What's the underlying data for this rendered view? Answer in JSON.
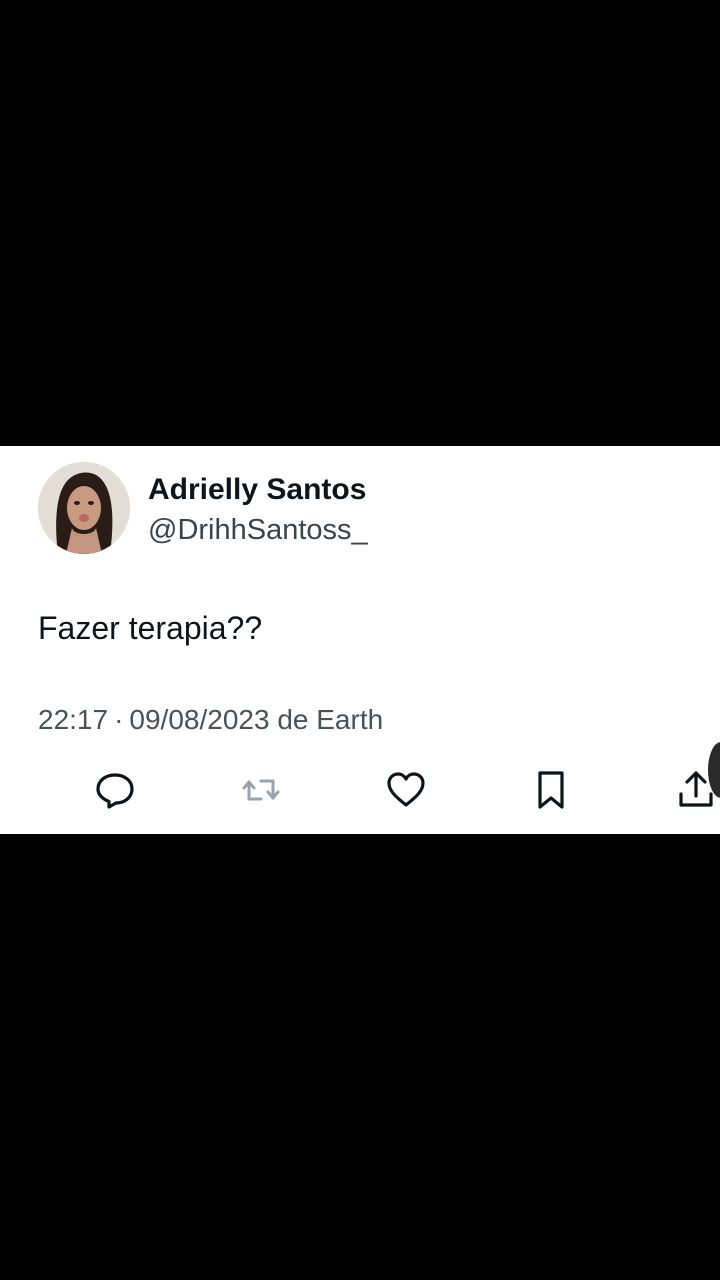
{
  "tweet": {
    "display_name": "Adrielly Santos",
    "handle": "@DrihhSantoss_",
    "text": "Fazer terapia??",
    "time": "22:17",
    "separator": "·",
    "date_source": "09/08/2023 de Earth"
  },
  "icons": {
    "reply": "reply-icon",
    "retweet": "retweet-icon",
    "like": "heart-icon",
    "bookmark": "bookmark-icon",
    "share": "share-icon"
  },
  "colors": {
    "background": "#000000",
    "card": "#ffffff",
    "text_primary": "#0f1419",
    "text_secondary": "#4b5257",
    "icon_dark": "#0f1419",
    "icon_muted": "#9aa3aa"
  }
}
